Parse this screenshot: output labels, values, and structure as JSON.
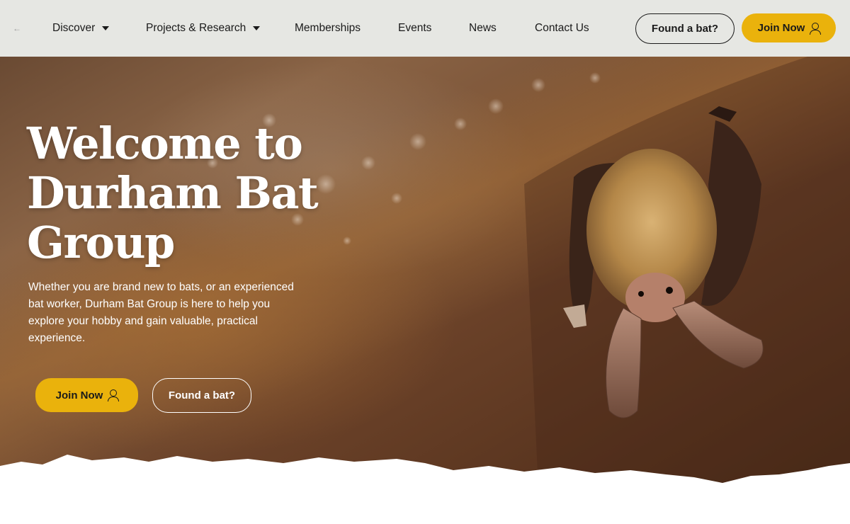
{
  "nav": {
    "logo_icon": "arrow-left-icon",
    "items": [
      {
        "label": "Discover",
        "has_dropdown": true
      },
      {
        "label": "Projects & Research",
        "has_dropdown": true
      },
      {
        "label": "Memberships",
        "has_dropdown": false
      },
      {
        "label": "Events",
        "has_dropdown": false
      },
      {
        "label": "News",
        "has_dropdown": false
      },
      {
        "label": "Contact Us",
        "has_dropdown": false
      }
    ],
    "found_bat_label": "Found a bat?",
    "join_label": "Join Now"
  },
  "hero": {
    "title": "Welcome to Durham Bat Group",
    "description": "Whether you are brand new to bats, or an experienced bat worker, Durham Bat Group is here to help you explore your hobby and gain valuable, practical experience.",
    "join_label": "Join Now",
    "found_bat_label": "Found a bat?",
    "image_subject": "brown long-eared bat hanging upside down from a cave ceiling"
  },
  "colors": {
    "nav_background": "#e6e7e3",
    "accent_yellow": "#eab20c",
    "text_dark": "#1a1a1a",
    "hero_text": "#ffffff"
  }
}
